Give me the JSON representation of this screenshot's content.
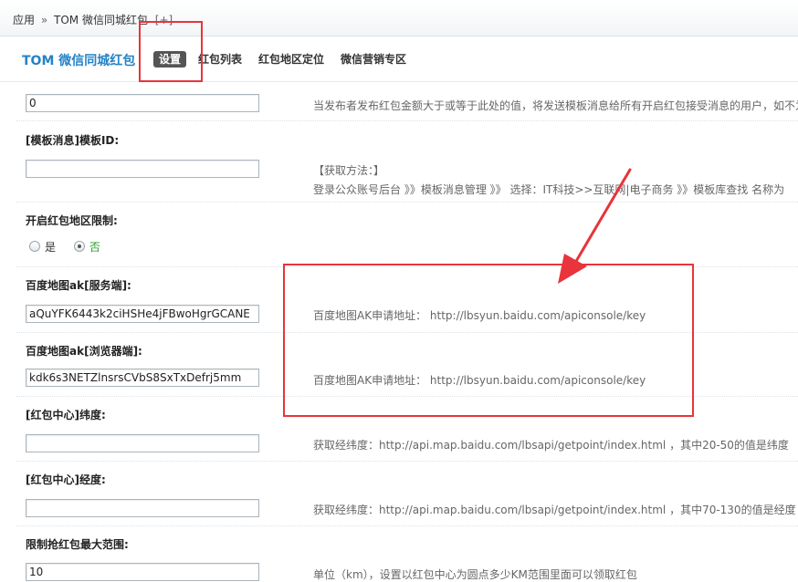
{
  "breadcrumb": {
    "root": "应用",
    "separator": "»",
    "current": "TOM 微信同城红包",
    "toggle": "[+]"
  },
  "nav": {
    "title": "TOM 微信同城红包",
    "tabs": [
      {
        "label": "设置",
        "active": true
      },
      {
        "label": "红包列表"
      },
      {
        "label": "红包地区定位"
      },
      {
        "label": "微信营销专区"
      }
    ]
  },
  "form": {
    "threshold": {
      "value": "0",
      "tip": "当发布者发布红包金额大于或等于此处的值，将发送模板消息给所有开启红包接受消息的用户，如不为"
    },
    "template_id": {
      "label": "[模板消息]模板ID:",
      "value": "",
      "tip_line1": "【获取方法：】",
      "tip_line2": "登录公众账号后台 》》模板消息管理 》》 选择：IT科技>>互联网|电子商务 》》模板库查找 名称为"
    },
    "region_limit": {
      "label": "开启红包地区限制:",
      "options": [
        {
          "label": "是",
          "checked": false
        },
        {
          "label": "否",
          "checked": true
        }
      ]
    },
    "baidu_ak_server": {
      "label": "百度地图ak[服务端]:",
      "value": "aQuYFK6443k2ciHSHe4jFBwoHgrGCANE",
      "tip": "百度地图AK申请地址： http://lbsyun.baidu.com/apiconsole/key"
    },
    "baidu_ak_browser": {
      "label": "百度地图ak[浏览器端]:",
      "value": "kdk6s3NETZlnsrsCVbS8SxTxDefrj5mm",
      "tip": "百度地图AK申请地址： http://lbsyun.baidu.com/apiconsole/key"
    },
    "center_lat": {
      "label": "[红包中心]纬度:",
      "value": "",
      "tip": "获取经纬度：http://api.map.baidu.com/lbsapi/getpoint/index.html ，其中20-50的值是纬度"
    },
    "center_lng": {
      "label": "[红包中心]经度:",
      "value": "",
      "tip": "获取经纬度：http://api.map.baidu.com/lbsapi/getpoint/index.html ，其中70-130的值是经度"
    },
    "max_range": {
      "label": "限制抢红包最大范围:",
      "value": "10",
      "tip": "单位（km），设置以红包中心为圆点多少KM范围里面可以领取红包"
    }
  },
  "colors": {
    "accent": "#2483c6",
    "annotation": "#e8343a",
    "radio_on": "#2a9c2a"
  }
}
